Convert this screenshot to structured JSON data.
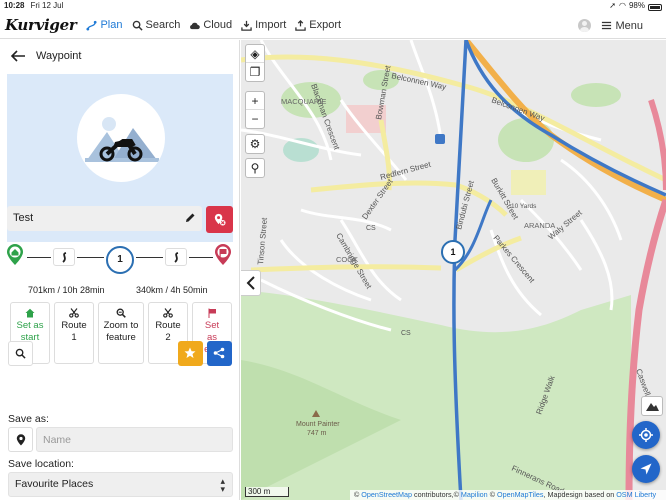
{
  "status": {
    "time": "10:28",
    "date": "Fri 12 Jul",
    "battery": "98%"
  },
  "app": {
    "logo": "Kurviger"
  },
  "nav": {
    "items": [
      {
        "label": "Plan",
        "icon": "route-icon"
      },
      {
        "label": "Search",
        "icon": "search-icon"
      },
      {
        "label": "Cloud",
        "icon": "cloud-icon"
      },
      {
        "label": "Import",
        "icon": "import-icon"
      },
      {
        "label": "Export",
        "icon": "export-icon"
      }
    ],
    "menu_label": "Menu"
  },
  "sidebar": {
    "title": "Waypoint",
    "waypoint_name": "Test",
    "route": {
      "waypoint_number": "1",
      "leg1": "701km / 10h 28min",
      "leg2": "340km / 4h 50min"
    },
    "actions": [
      {
        "label": "Set as start"
      },
      {
        "label": "Route 1"
      },
      {
        "label": "Zoom to feature"
      },
      {
        "label": "Route 2"
      },
      {
        "label": "Set as end"
      }
    ],
    "save_as_label": "Save as:",
    "name_placeholder": "Name",
    "save_location_label": "Save location:",
    "save_location_value": "Favourite Places"
  },
  "map": {
    "labels": {
      "road1": "Belconnen Way",
      "road1b": "Belconnen Way",
      "blackman": "Blackman Crescent",
      "macquarie": "MACQUARIE",
      "bowman": "Bowman Street",
      "redfern": "Redfern Street",
      "dexter": "Dexter Street",
      "cambridge": "Cambridge Street",
      "cook": "COOK",
      "aranda": "ARANDA",
      "bindubi": "Bindubi Street",
      "parkes": "Parkes Crescent",
      "waly": "Waly Street",
      "burkitt": "Burkitt Street",
      "tenyards": "10 Yards",
      "caswell": "Caswell Drive",
      "ridgewalk": "Ridge Walk",
      "finnerans": "Finnerans Road",
      "mountpainter": "Mount Painter",
      "elevation": "747 m",
      "cs1": "CS",
      "cs2": "CS",
      "tinson": "Tinson Street",
      "marker_num": "1"
    },
    "scale": "300 m",
    "attribution": {
      "prefix": "©",
      "osm": "OpenStreetMap",
      "contrib": "contributors,©",
      "mapilion": "Mapilion",
      "sep": "©",
      "omt": "OpenMapTiles",
      "design": ", Mapdesign based on",
      "liberty": "OSM Liberty"
    }
  },
  "colors": {
    "accent": "#1f7ad6",
    "route": "#3f78c6",
    "start": "#2ea24a",
    "end": "#c73b57",
    "star": "#f0a91c",
    "share": "#2266c9"
  }
}
